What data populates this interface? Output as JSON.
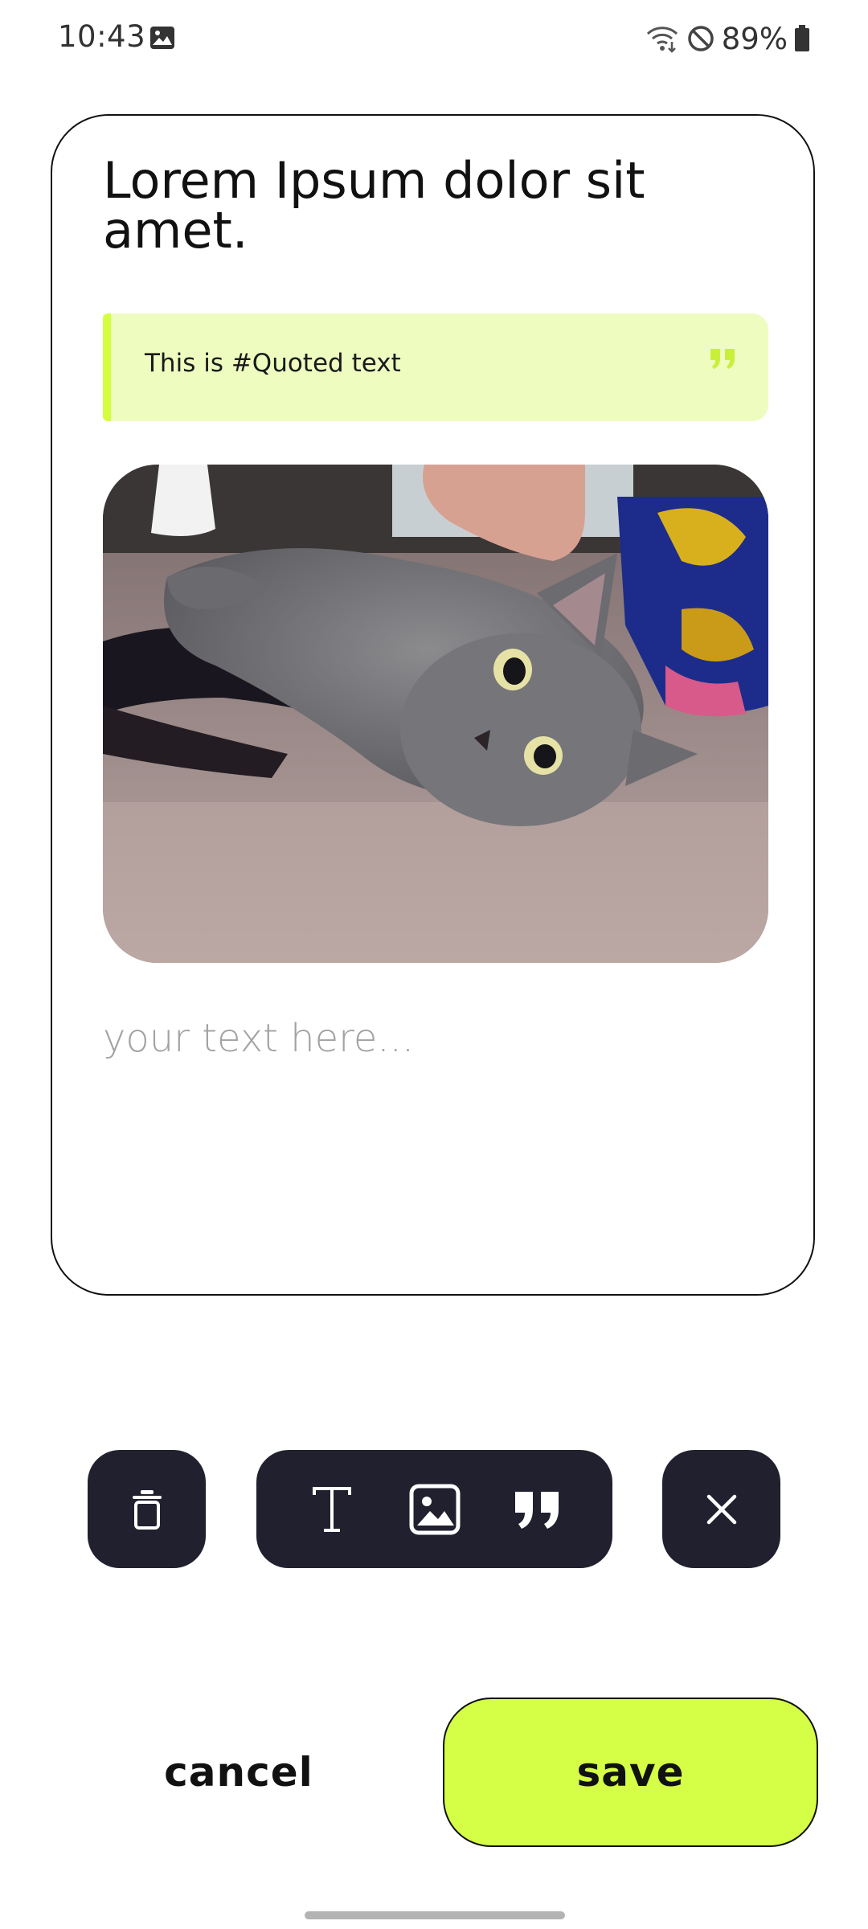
{
  "status_bar": {
    "time": "10:43",
    "battery": "89%",
    "icons": [
      "image-icon",
      "wifi-icon",
      "do-not-disturb-icon",
      "battery-icon"
    ]
  },
  "note": {
    "title": "Lorem Ipsum dolor sit amet.",
    "quote": "This is #Quoted text",
    "image_icon": "photo",
    "body_placeholder": "your text here..."
  },
  "toolbar": {
    "icons": [
      "trash-icon",
      "text-icon",
      "image-icon",
      "quote-icon",
      "close-icon"
    ]
  },
  "actions": {
    "cancel_label": "cancel",
    "save_label": "save"
  },
  "colors": {
    "accent": "#d4ff46",
    "quote_background": "#eefcc0",
    "toolbar": "#20202f",
    "border": "#111111"
  }
}
